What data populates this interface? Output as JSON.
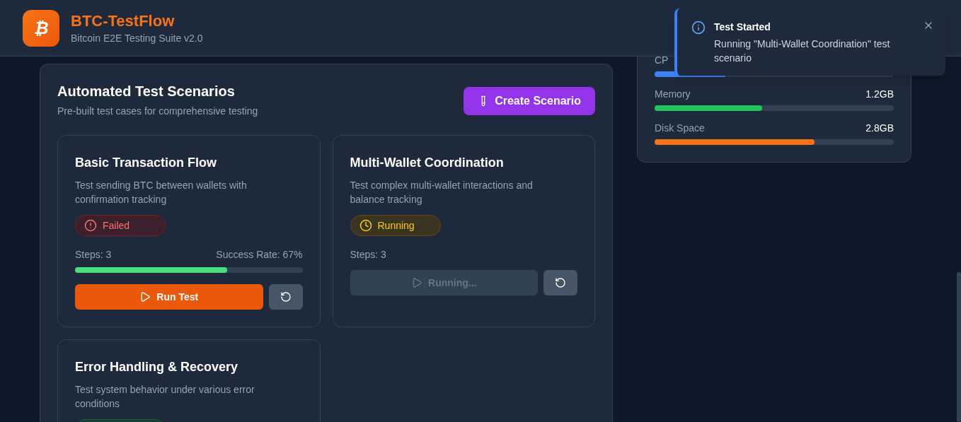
{
  "header": {
    "logo_glyph": "₿",
    "title": "BTC-TestFlow",
    "subtitle": "Bitcoin E2E Testing Suite v2.0"
  },
  "scenarios": {
    "title": "Automated Test Scenarios",
    "subtitle": "Pre-built test cases for comprehensive testing",
    "create_button": "Create Scenario",
    "cards": [
      {
        "title": "Basic Transaction Flow",
        "description": "Test sending BTC between wallets with confirmation tracking",
        "kind": "failed",
        "status_label": "Failed",
        "steps": "Steps: 3",
        "success_rate": "Success Rate: 67%",
        "level": 0.67,
        "run_button": "Run Test",
        "running": false
      },
      {
        "title": "Multi-Wallet Coordination",
        "description": "Test complex multi-wallet interactions and balance tracking",
        "kind": "running",
        "status_label": "Running",
        "steps": "Steps: 3",
        "run_button": "Running...",
        "running": true
      },
      {
        "title": "Error Handling & Recovery",
        "description": "Test system behavior under various error conditions",
        "kind": "passed"
      }
    ]
  },
  "resources": [
    {
      "label": "CP",
      "level": 0.3,
      "color": "#3b82f6"
    },
    {
      "label": "Memory",
      "value": "1.2GB",
      "level": 0.45,
      "color": "#22c55e"
    },
    {
      "label": "Disk Space",
      "value": "2.8GB",
      "level": 0.67,
      "color": "#f97316"
    }
  ],
  "toast": {
    "title": "Test Started",
    "message": "Running \"Multi-Wallet Coordination\" test scenario"
  }
}
